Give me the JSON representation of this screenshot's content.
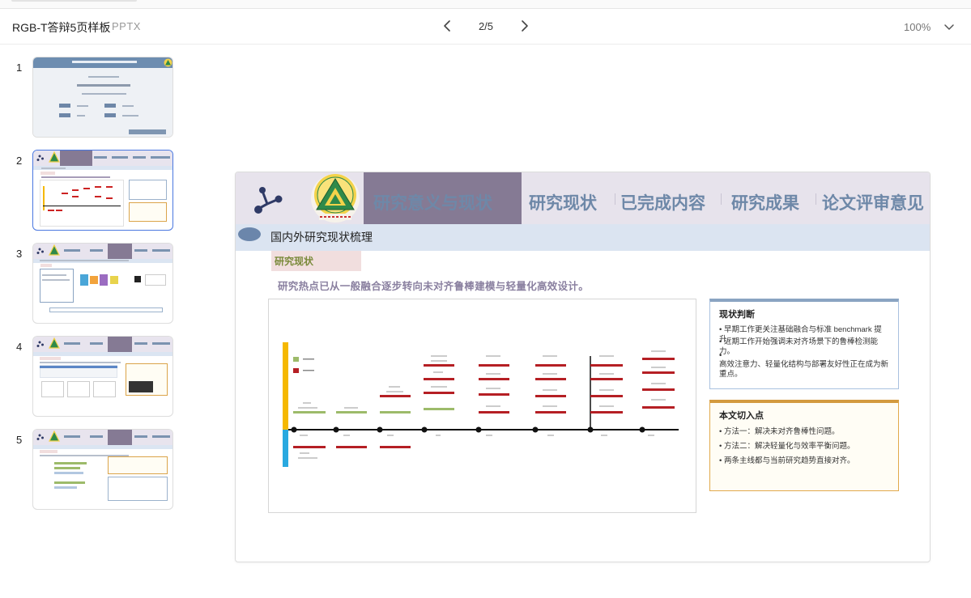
{
  "app": {
    "doc_title": "RGB-T答辩5页样板",
    "doc_type": "PPTX",
    "page_indicator": "2/5",
    "zoom": "100%"
  },
  "icons": {
    "prev": "chevron-left-icon",
    "next": "chevron-right-icon",
    "zoom_dropdown": "chevron-down-icon",
    "share": "share-icon",
    "logo": "university-emblem"
  },
  "thumbnails": [
    {
      "num": "1",
      "active": false
    },
    {
      "num": "2",
      "active": true
    },
    {
      "num": "3",
      "active": false
    },
    {
      "num": "4",
      "active": false
    },
    {
      "num": "5",
      "active": false
    }
  ],
  "slide": {
    "tabs": [
      "研究意义与现状",
      "研究现状",
      "已完成内容",
      "研究成果",
      "论文评审意见"
    ],
    "active_tab_index": 0,
    "subtitle": "国内外研究现状梳理",
    "tag": "研究现状",
    "lead": "研究热点已从一般融合逐步转向未对齐鲁棒建模与轻量化高效设计。",
    "card1": {
      "title": "现状判断",
      "lines": [
        "• 早期工作更关注基础融合与标准 benchmark 提升。",
        "• 近期工作开始强调未对齐场景下的鲁棒检测能力。",
        "•",
        "高效注意力、轻量化结构与部署友好性正在成为新重点。"
      ]
    },
    "card2": {
      "title": "本文切入点",
      "lines": [
        "• 方法一：解决未对齐鲁棒性问题。",
        "• 方法二：解决轻量化与效率平衡问题。",
        "• 两条主线都与当前研究趋势直接对齐。"
      ]
    }
  },
  "colors": {
    "accent_blue": "#4a78e0",
    "header_purple": "#857a94",
    "tab_blue": "#6e88a8",
    "card_gold": "#d39a3f",
    "timeline_yellow": "#f5b800",
    "timeline_cyan": "#29a9e0",
    "marker_red": "#b51f24",
    "marker_green": "#9dbb6a"
  }
}
